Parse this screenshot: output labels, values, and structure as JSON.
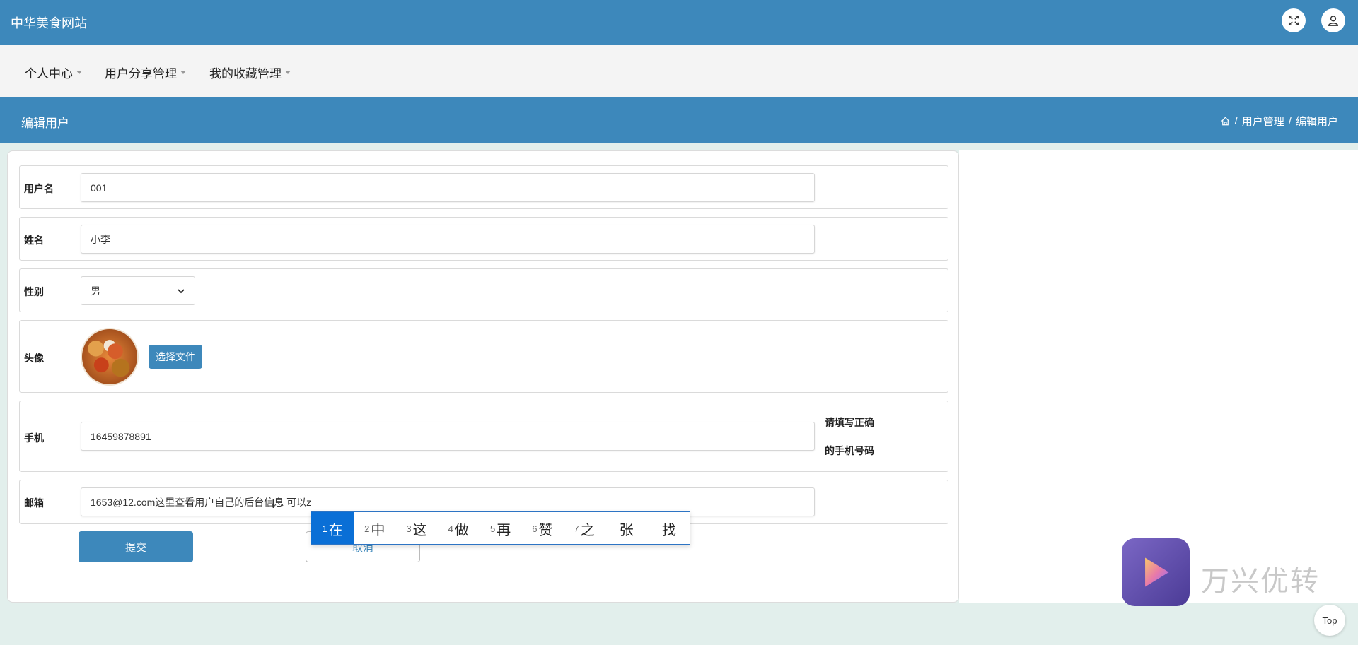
{
  "app": {
    "title": "中华美食网站"
  },
  "header_icons": [
    "fullscreen-icon",
    "user-icon"
  ],
  "nav": {
    "items": [
      {
        "label": "个人中心"
      },
      {
        "label": "用户分享管理"
      },
      {
        "label": "我的收藏管理"
      }
    ]
  },
  "page": {
    "title": "编辑用户",
    "breadcrumb": [
      "用户管理",
      "编辑用户"
    ]
  },
  "form": {
    "username": {
      "label": "用户名",
      "value": "001"
    },
    "name": {
      "label": "姓名",
      "value": "小李"
    },
    "gender": {
      "label": "性别",
      "value": "男"
    },
    "avatar": {
      "label": "头像",
      "button": "选择文件"
    },
    "phone": {
      "label": "手机",
      "value": "16459878891",
      "hint_line1": "请填写正确",
      "hint_line2": "的手机号码"
    },
    "email": {
      "label": "邮箱",
      "value": "1653@12.com这里查看用户自己的后台信息  可以z"
    },
    "submit": "提交",
    "cancel": "取消"
  },
  "ime": {
    "candidates": [
      {
        "num": "1",
        "text": "在"
      },
      {
        "num": "2",
        "text": "中"
      },
      {
        "num": "3",
        "text": "这"
      },
      {
        "num": "4",
        "text": "做"
      },
      {
        "num": "5",
        "text": "再"
      },
      {
        "num": "6",
        "text": "赞"
      },
      {
        "num": "7",
        "text": "之"
      },
      {
        "num": "",
        "text": "张"
      },
      {
        "num": "",
        "text": "找"
      }
    ]
  },
  "watermark": {
    "text": "万兴优转"
  },
  "top_button": "Top",
  "colors": {
    "primary": "#3d88bb",
    "ime_active": "#0a6fd6"
  }
}
